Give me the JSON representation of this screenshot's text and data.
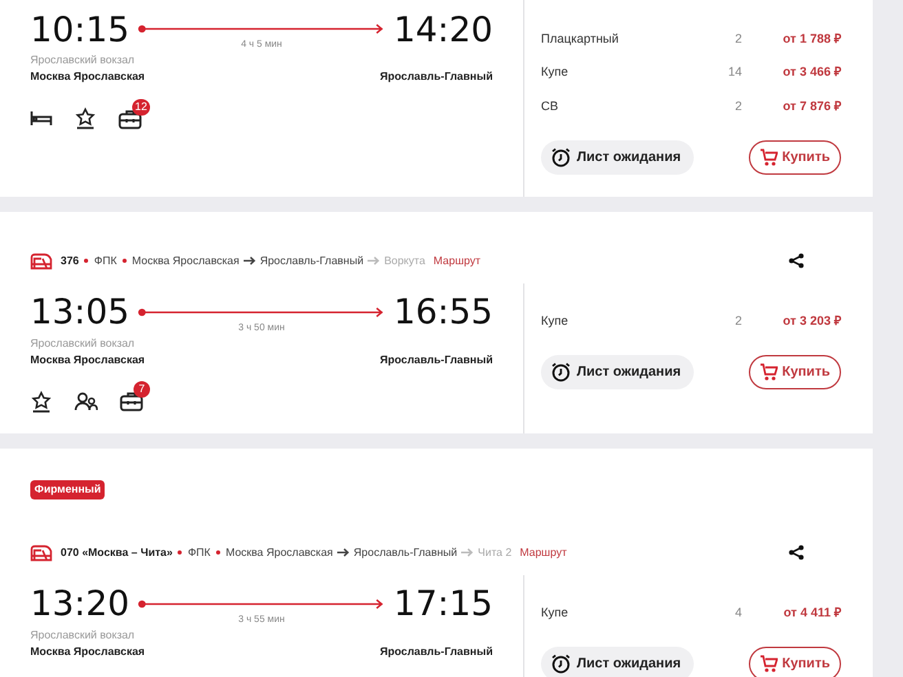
{
  "trains": [
    {
      "departure": {
        "time": "10:15",
        "station_label": "Ярославский вокзал",
        "station": "Москва Ярославская"
      },
      "arrival": {
        "time": "14:20",
        "station": "Ярославль-Главный"
      },
      "duration": "4 ч 5 мин",
      "amenities": [
        {
          "kind": "bed"
        },
        {
          "kind": "star"
        },
        {
          "kind": "luggage",
          "count": "12"
        }
      ],
      "classes": [
        {
          "name": "Плацкартный",
          "seats": "2",
          "price": "от 1 788 ₽"
        },
        {
          "name": "Купе",
          "seats": "14",
          "price": "от 3 466 ₽"
        },
        {
          "name": "СВ",
          "seats": "2",
          "price": "от 7 876 ₽"
        }
      ],
      "waitlist_label": "Лист ожидания",
      "buy_label": "Купить"
    },
    {
      "header": {
        "number": "376",
        "carrier": "ФПК",
        "from": "Москва Ярославская",
        "to": "Ярославль-Главный",
        "terminus": "Воркута",
        "route_link": "Маршрут"
      },
      "departure": {
        "time": "13:05",
        "station_label": "Ярославский вокзал",
        "station": "Москва Ярославская"
      },
      "arrival": {
        "time": "16:55",
        "station": "Ярославль-Главный"
      },
      "duration": "3 ч 50 мин",
      "amenities": [
        {
          "kind": "star"
        },
        {
          "kind": "people"
        },
        {
          "kind": "luggage",
          "count": "7"
        }
      ],
      "classes": [
        {
          "name": "Купе",
          "seats": "2",
          "price": "от 3 203 ₽"
        }
      ],
      "waitlist_label": "Лист ожидания",
      "buy_label": "Купить"
    },
    {
      "badge": "Фирменный",
      "header": {
        "number": "070 «Москва – Чита»",
        "carrier": "ФПК",
        "from": "Москва Ярославская",
        "to": "Ярославль-Главный",
        "terminus": "Чита 2",
        "route_link": "Маршрут"
      },
      "departure": {
        "time": "13:20",
        "station_label": "Ярославский вокзал",
        "station": "Москва Ярославская"
      },
      "arrival": {
        "time": "17:15",
        "station": "Ярославль-Главный"
      },
      "duration": "3 ч 55 мин",
      "classes": [
        {
          "name": "Купе",
          "seats": "4",
          "price": "от 4 411 ₽"
        }
      ],
      "waitlist_label": "Лист ожидания",
      "buy_label": "Купить"
    }
  ]
}
